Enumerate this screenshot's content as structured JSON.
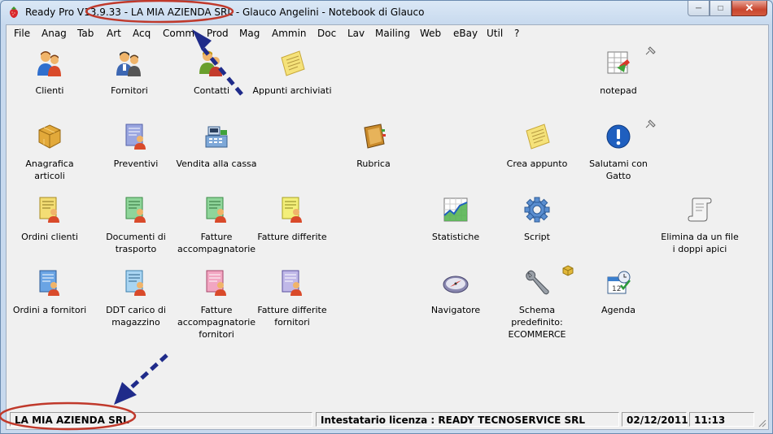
{
  "window": {
    "title": "Ready Pro V13.9.33 - LA MIA AZIENDA SRL - Glauco Angelini - Notebook di Glauco"
  },
  "menu": [
    "File",
    "Anag",
    "Tab",
    "Art",
    "Acq",
    "Comm",
    "Prod",
    "Mag",
    "Ammin",
    "Doc",
    "Lav",
    "Mailing",
    "Web",
    "eBay",
    "Util",
    "?"
  ],
  "tiles": {
    "clienti": "Clienti",
    "fornitori": "Fornitori",
    "contatti": "Contatti",
    "appunti_archiviati": "Appunti archiviati",
    "notepad": "notepad",
    "anagrafica_articoli": "Anagrafica articoli",
    "preventivi": "Preventivi",
    "vendita_cassa": "Vendita alla cassa",
    "rubrica": "Rubrica",
    "crea_appunto": "Crea appunto",
    "salutami": "Salutami con Gatto",
    "ordini_clienti": "Ordini clienti",
    "documenti_trasporto": "Documenti di trasporto",
    "fatture_accompagnatorie": "Fatture accompagnatorie",
    "fatture_differite": "Fatture differite",
    "statistiche": "Statistiche",
    "script": "Script",
    "elimina_doppi_apici": "Elimina da un file i doppi apici",
    "ordini_fornitori": "Ordini a fornitori",
    "ddt_carico": "DDT carico di magazzino",
    "fatture_acc_fornitori": "Fatture accompagnatorie fornitori",
    "fatture_diff_fornitori": "Fatture differite fornitori",
    "navigatore": "Navigatore",
    "schema_predefinito": "Schema predefinito: ECOMMERCE",
    "agenda": "Agenda"
  },
  "status": {
    "company": "LA MIA AZIENDA SRL",
    "license": "Intestatario licenza : READY TECNOSERVICE SRL",
    "date": "02/12/2011",
    "time": "11:13"
  },
  "colors": {
    "annotation_red": "#c0392b",
    "annotation_arrow": "#1f2b8a"
  }
}
